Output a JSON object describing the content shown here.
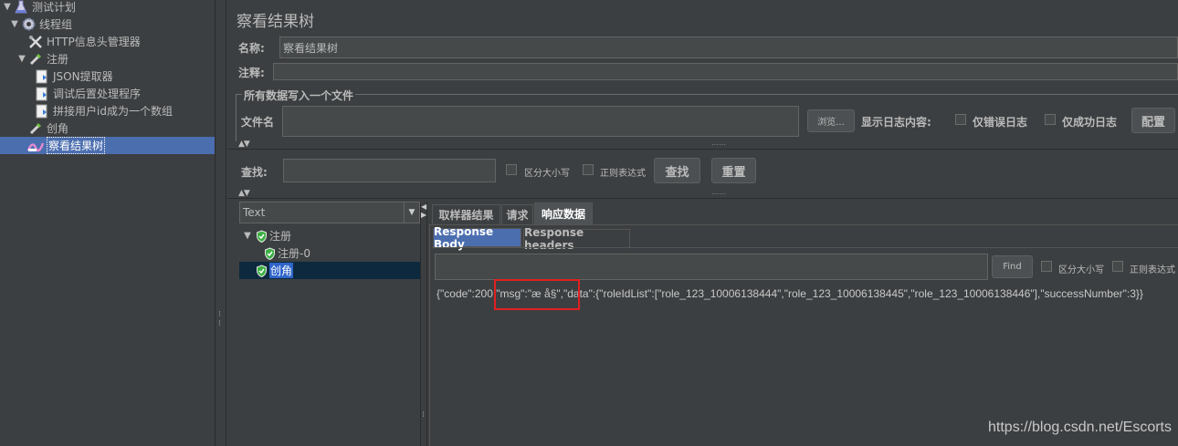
{
  "tree": {
    "items": [
      {
        "label": "测试计划",
        "icon": "flask-icon"
      },
      {
        "label": "线程组",
        "icon": "gear-icon"
      },
      {
        "label": "HTTP信息头管理器",
        "icon": "tools-icon"
      },
      {
        "label": "注册",
        "icon": "pipette-icon"
      },
      {
        "label": "JSON提取器",
        "icon": "document-icon"
      },
      {
        "label": "调试后置处理程序",
        "icon": "document-icon"
      },
      {
        "label": "拼接用户id成为一个数组",
        "icon": "document-icon"
      },
      {
        "label": "创角",
        "icon": "pipette-icon"
      },
      {
        "label": "察看结果树",
        "icon": "listener-icon"
      }
    ]
  },
  "panel": {
    "title": "察看结果树",
    "name_label": "名称:",
    "name_value": "察看结果树",
    "comment_label": "注释:",
    "comment_value": "",
    "file_group_title": "所有数据写入一个文件",
    "filename_label": "文件名",
    "filename_value": "",
    "browse_label": "浏览...",
    "log_content_label": "显示日志内容:",
    "errors_only_label": "仅错误日志",
    "success_only_label": "仅成功日志",
    "configure_label": "配置"
  },
  "search": {
    "label": "查找:",
    "value": "",
    "case_label": "区分大小写",
    "regex_label": "正则表达式",
    "find_button": "查找",
    "reset_button": "重置"
  },
  "results": {
    "renderer": "Text",
    "items": [
      {
        "label": "注册"
      },
      {
        "label": "注册-0"
      },
      {
        "label": "创角"
      }
    ]
  },
  "tabs": [
    "取样器结果",
    "请求",
    "响应数据"
  ],
  "subtabs": [
    "Response Body",
    "Response headers"
  ],
  "response": {
    "find_button": "Find",
    "case_label": "区分大小写",
    "regex_label": "正则表达式",
    "body_text": "{\"code\":200,\"msg\":\"æ  å§\",\"data\":{\"roleIdList\":[\"role_123_10006138444\",\"role_123_10006138445\",\"role_123_10006138446\"],\"successNumber\":3}}"
  },
  "watermark": "https://blog.csdn.net/Escorts",
  "colors": {
    "background": "#3c3f41",
    "selection": "#4b6eaf",
    "highlight_box": "#e02020"
  }
}
